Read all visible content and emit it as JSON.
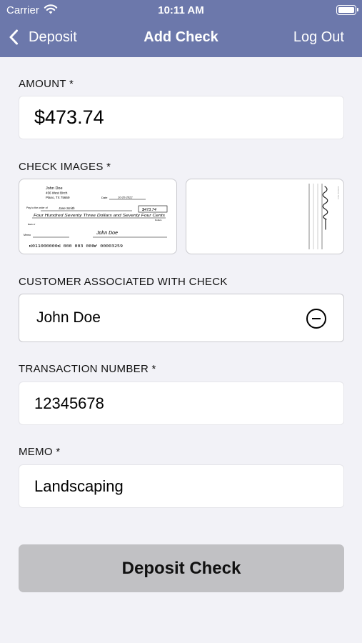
{
  "status_bar": {
    "carrier": "Carrier",
    "time": "10:11 AM"
  },
  "nav": {
    "back_label": "Deposit",
    "title": "Add Check",
    "logout_label": "Log Out"
  },
  "amount": {
    "label": "AMOUNT *",
    "value": "$473.74"
  },
  "check_images": {
    "label": "CHECK IMAGES *",
    "front": {
      "payer_name": "John Doe",
      "payer_address1": "456 West Birch",
      "payer_address2": "Plano, TX 75669",
      "date_label": "Date",
      "date_value": "10-20-2022",
      "pay_to_label": "Pay to the order of",
      "payee": "Jane Smith",
      "amount_box": "$473.74",
      "written_amount": "Four Hundred Seventy Three Dollars and Seventy Four Cents",
      "dollars_label": "Dollars",
      "bank_label": "Bank of",
      "memo_label": "Memo",
      "signature": "John Doe",
      "micr_line": "⑆011000000⑆ 000 003 000⑈ 00003259"
    },
    "back": {
      "endorse_label": "Endorse here"
    }
  },
  "customer": {
    "label": "CUSTOMER ASSOCIATED WITH CHECK",
    "value": "John Doe",
    "remove_icon": "minus-circle-icon"
  },
  "transaction": {
    "label": "TRANSACTION NUMBER *",
    "value": "12345678"
  },
  "memo": {
    "label": "MEMO *",
    "value": "Landscaping"
  },
  "deposit_button": {
    "label": "Deposit Check"
  },
  "colors": {
    "header": "#6c78ab",
    "background": "#f2f2f7",
    "button_disabled": "#c1c1c4"
  }
}
